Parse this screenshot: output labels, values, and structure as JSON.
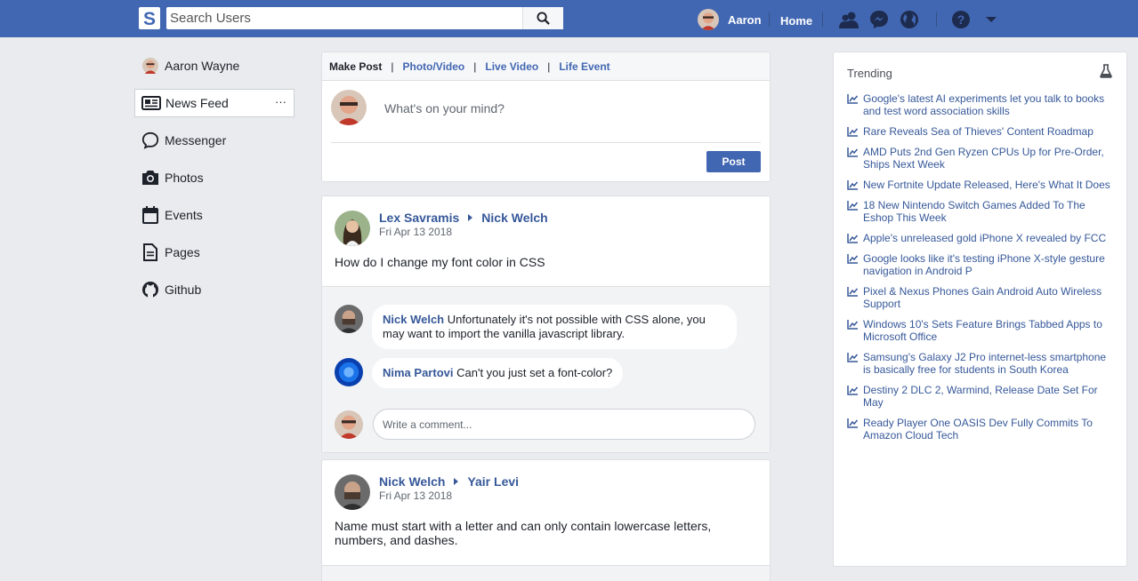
{
  "header": {
    "logo_letter": "S",
    "search_placeholder": "Search Users",
    "username": "Aaron",
    "home_label": "Home",
    "icons": [
      "friends-icon",
      "messenger-icon",
      "globe-icon",
      "help-icon",
      "caret-down-icon"
    ]
  },
  "leftnav": {
    "profile_name": "Aaron Wayne",
    "items": [
      {
        "label": "News Feed",
        "icon": "newsfeed-icon",
        "active": true,
        "more": "···"
      },
      {
        "label": "Messenger",
        "icon": "messenger-icon"
      },
      {
        "label": "Photos",
        "icon": "camera-icon"
      },
      {
        "label": "Events",
        "icon": "calendar-icon"
      },
      {
        "label": "Pages",
        "icon": "document-icon"
      },
      {
        "label": "Github",
        "icon": "github-icon"
      }
    ]
  },
  "composer": {
    "tabs": [
      "Make Post",
      "Photo/Video",
      "Live Video",
      "Life Event"
    ],
    "placeholder": "What's on your mind?",
    "post_label": "Post"
  },
  "posts": [
    {
      "author": "Lex Savramis",
      "target": "Nick Welch",
      "date": "Fri Apr 13 2018",
      "text": "How do I change my font color in CSS",
      "comments": [
        {
          "name": "Nick Welch",
          "text": "Unfortunately it's not possible with CSS alone, you may want to import the vanilla javascript library."
        },
        {
          "name": "Nima Partovi",
          "text": "Can't you just set a font-color?"
        }
      ],
      "comment_placeholder": "Write a comment..."
    },
    {
      "author": "Nick Welch",
      "target": "Yair Levi",
      "date": "Fri Apr 13 2018",
      "text": "Name must start with a letter and can only contain lowercase letters, numbers, and dashes."
    }
  ],
  "trending": {
    "title": "Trending",
    "items": [
      "Google's latest AI experiments let you talk to books and test word association skills",
      "Rare Reveals Sea of Thieves' Content Roadmap",
      "AMD Puts 2nd Gen Ryzen CPUs Up for Pre-Order, Ships Next Week",
      "New Fortnite Update Released, Here's What It Does",
      "18 New Nintendo Switch Games Added To The Eshop This Week",
      "Apple's unreleased gold iPhone X revealed by FCC",
      "Google looks like it's testing iPhone X-style gesture navigation in Android P",
      "Pixel & Nexus Phones Gain Android Auto Wireless Support",
      "Windows 10's Sets Feature Brings Tabbed Apps to Microsoft Office",
      "Samsung's Galaxy J2 Pro internet-less smartphone is basically free for students in South Korea",
      "Destiny 2 DLC 2, Warmind, Release Date Set For May",
      "Ready Player One OASIS Dev Fully Commits To Amazon Cloud Tech"
    ]
  },
  "colors": {
    "brand": "#4267b2",
    "link": "#365899",
    "background": "#e9ebee"
  }
}
